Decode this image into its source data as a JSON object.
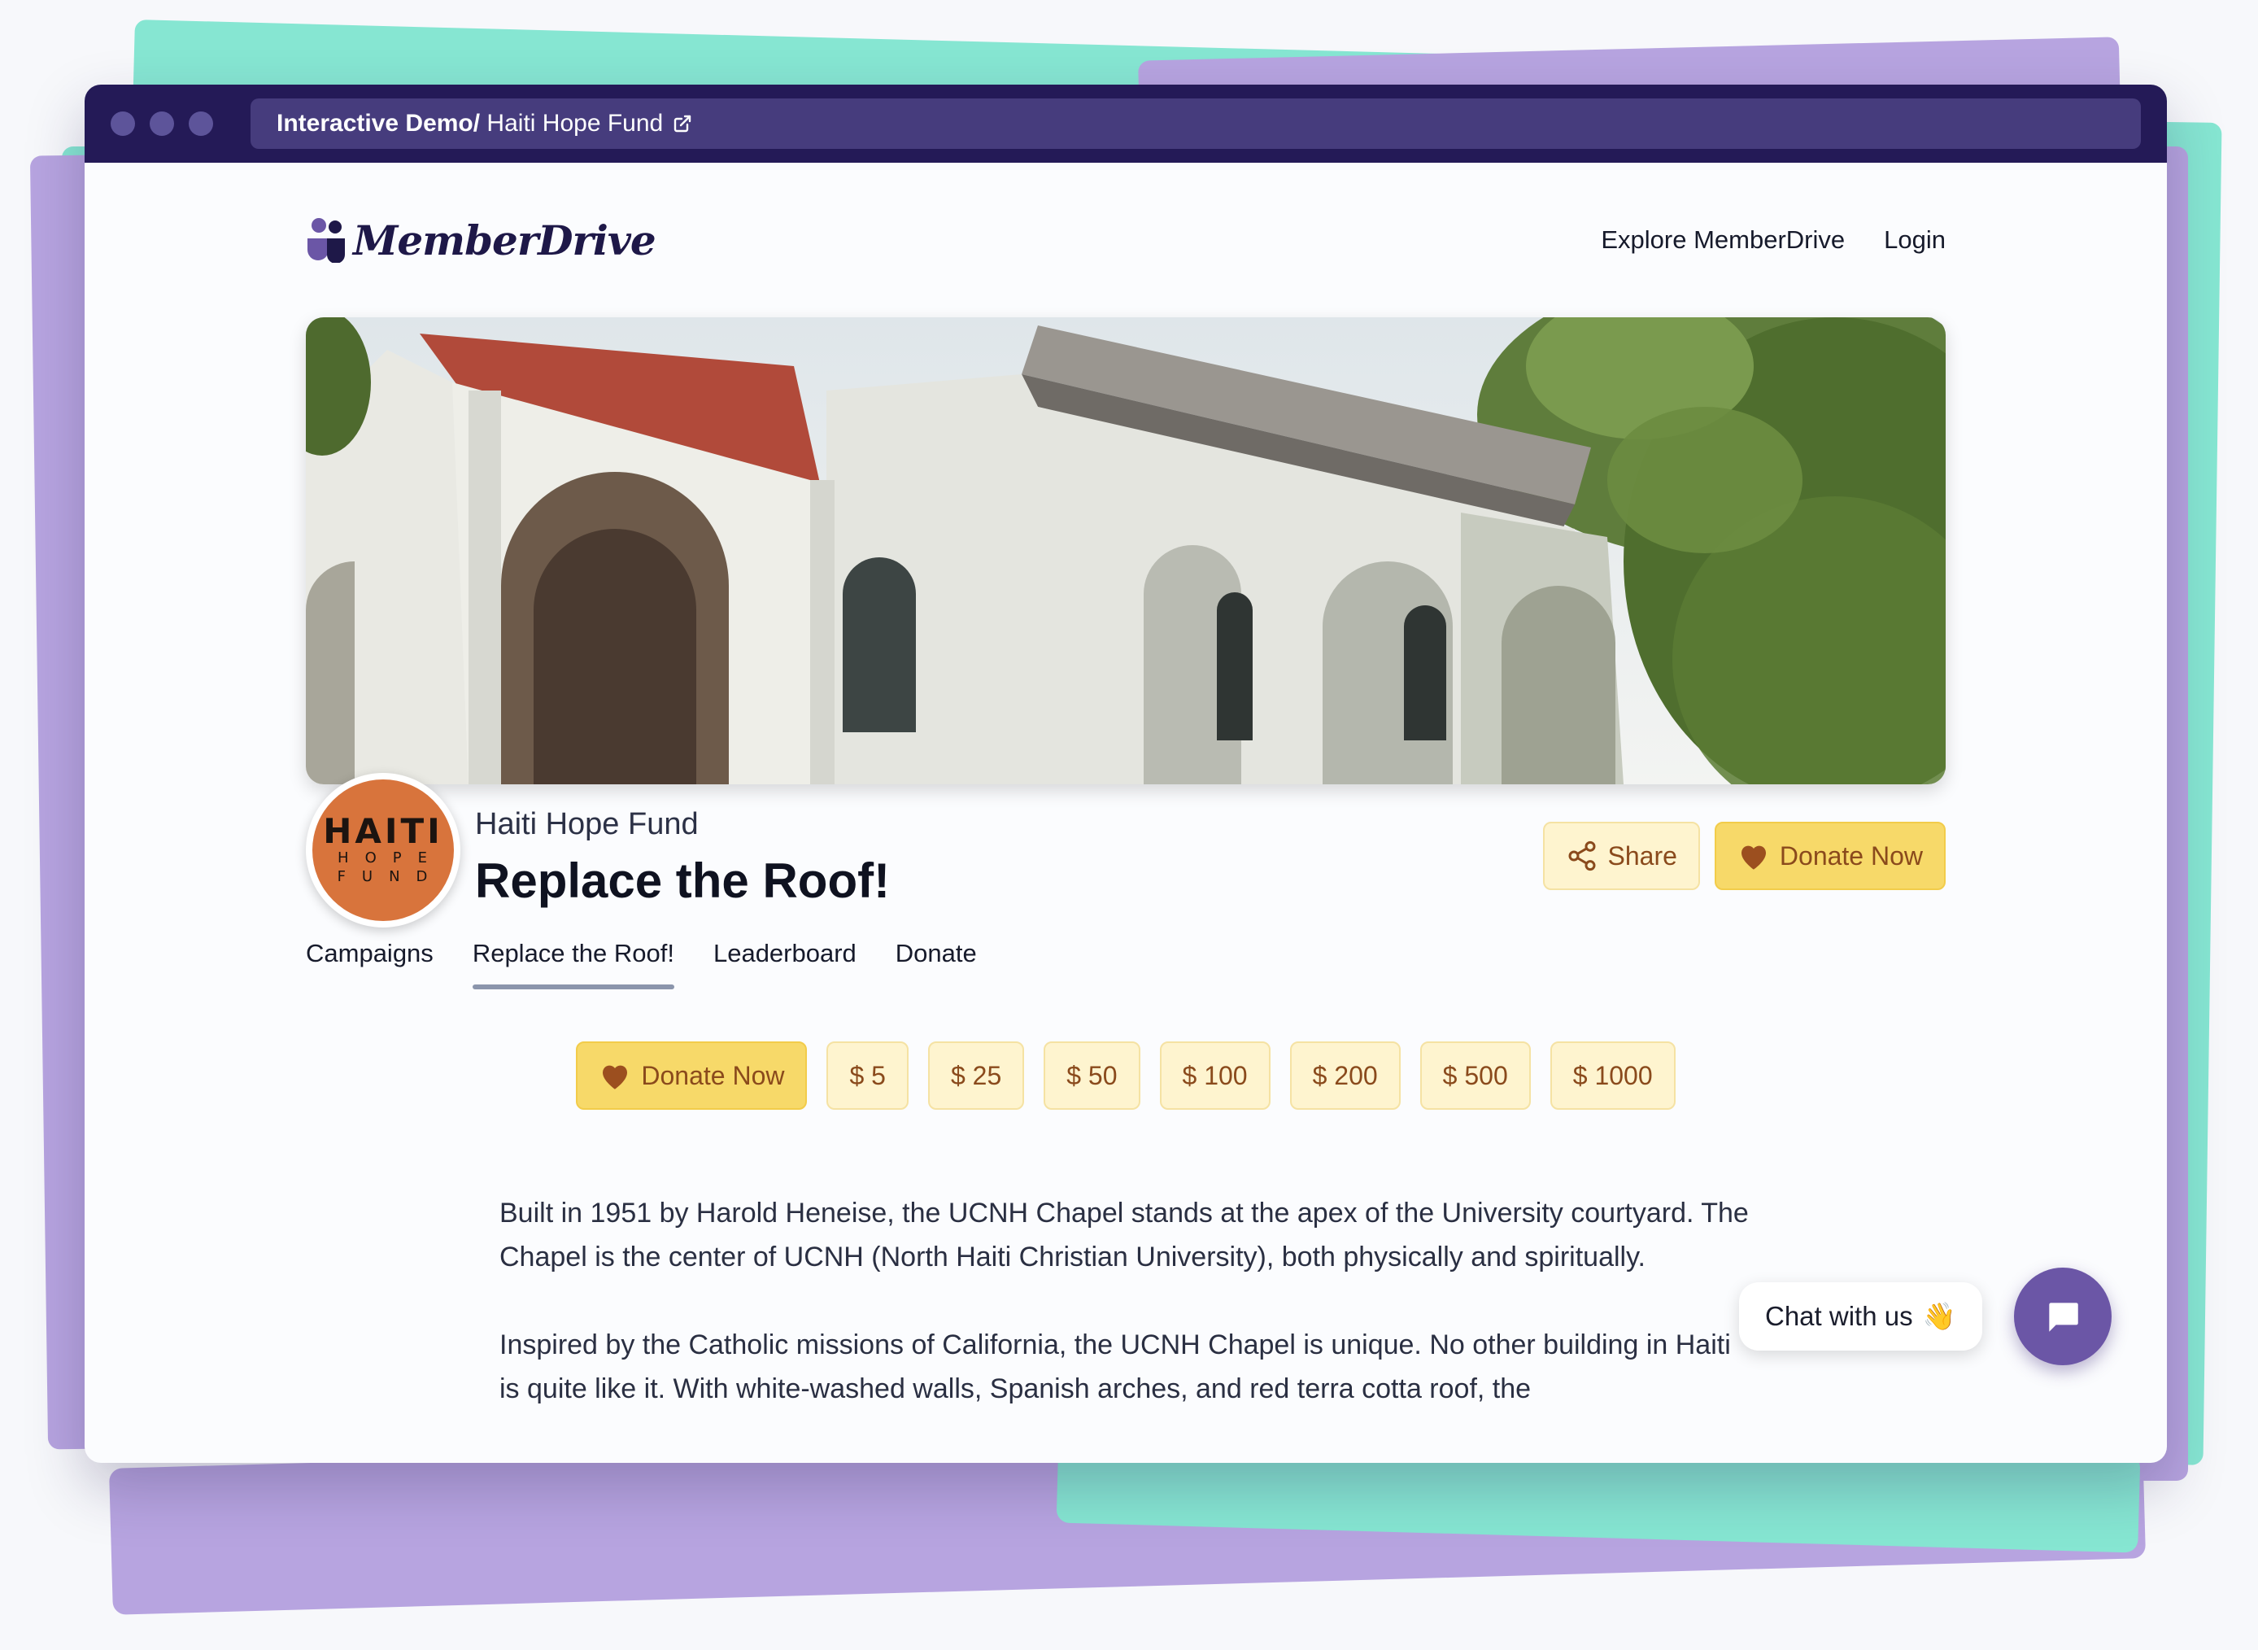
{
  "browser": {
    "breadcrumb_strong": "Interactive Demo/",
    "breadcrumb_rest": " Haiti Hope Fund"
  },
  "nav": {
    "logo_text": "MemberDrive",
    "links": [
      "Explore MemberDrive",
      "Login"
    ]
  },
  "org": {
    "logo_lines": [
      "HAITI",
      "HOPE",
      "FUND"
    ],
    "name": "Haiti Hope Fund",
    "campaign_title": "Replace the Roof!"
  },
  "actions": {
    "share_label": "Share",
    "donate_label": "Donate Now"
  },
  "tabs": [
    {
      "label": "Campaigns",
      "active": false
    },
    {
      "label": "Replace the Roof!",
      "active": true
    },
    {
      "label": "Leaderboard",
      "active": false
    },
    {
      "label": "Donate",
      "active": false
    }
  ],
  "donate_bar": {
    "donate_label": "Donate Now",
    "amounts": [
      "$ 5",
      "$ 25",
      "$ 50",
      "$ 100",
      "$ 200",
      "$ 500",
      "$ 1000"
    ]
  },
  "description": {
    "paragraphs": [
      "Built in 1951 by Harold Heneise, the UCNH Chapel stands at the apex of the University courtyard. The Chapel is the center of UCNH (North Haiti Christian University), both physically and spiritually.",
      "Inspired by the Catholic missions of California, the UCNH Chapel is unique. No other building in Haiti is quite like it. With white-washed walls, Spanish arches, and red terra cotta roof, the"
    ]
  },
  "chat": {
    "label": "Chat with us",
    "wave_emoji": "👋"
  },
  "colors": {
    "titlebar": "#241a57",
    "accent_yellow": "#f7d969",
    "button_text": "#8a4a1c",
    "chat_fab": "#6b56a6"
  }
}
